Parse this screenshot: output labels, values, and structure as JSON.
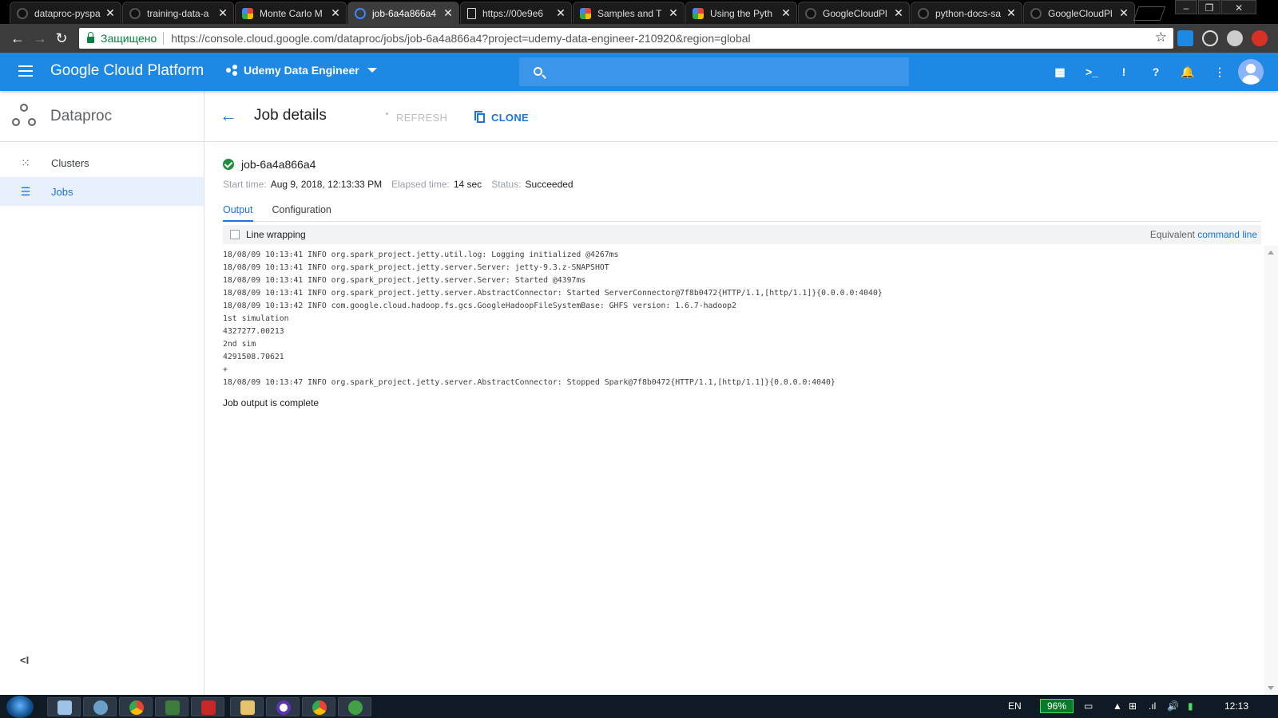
{
  "browser": {
    "tabs": [
      {
        "title": "dataproc-pyspa",
        "icon": "github-icon",
        "active": false
      },
      {
        "title": "training-data-a",
        "icon": "github-icon",
        "active": false
      },
      {
        "title": "Monte Carlo M",
        "icon": "google-cloud-icon",
        "active": false
      },
      {
        "title": "job-6a4a866a4",
        "icon": "dataproc-icon",
        "active": true
      },
      {
        "title": "https://00e9e6",
        "icon": "document-icon",
        "active": false
      },
      {
        "title": "Samples and T",
        "icon": "google-cloud-icon",
        "active": false
      },
      {
        "title": "Using the Pyth",
        "icon": "google-cloud-icon",
        "active": false
      },
      {
        "title": "GoogleCloudPl",
        "icon": "github-icon",
        "active": false
      },
      {
        "title": "python-docs-sa",
        "icon": "github-icon",
        "active": false
      },
      {
        "title": "GoogleCloudPl",
        "icon": "github-icon",
        "active": false
      }
    ],
    "secure_label": "Защищено",
    "url": "https://console.cloud.google.com/dataproc/jobs/job-6a4a866a4?project=udemy-data-engineer-210920&region=global"
  },
  "header": {
    "brand": "Google Cloud Platform",
    "project": "Udemy Data Engineer",
    "accent_color": "#1e88e5"
  },
  "sidebar": {
    "title": "Dataproc",
    "items": [
      {
        "label": "Clusters",
        "icon": "clusters-icon",
        "active": false
      },
      {
        "label": "Jobs",
        "icon": "list-icon",
        "active": true
      }
    ],
    "collapse_label": "<I"
  },
  "toolbar": {
    "title": "Job details",
    "refresh_label": "REFRESH",
    "clone_label": "CLONE"
  },
  "job": {
    "id": "job-6a4a866a4",
    "start_label": "Start time:",
    "start_time": "Aug 9, 2018, 12:13:33 PM",
    "elapsed_label": "Elapsed time:",
    "elapsed": "14 sec",
    "status_label": "Status:",
    "status": "Succeeded",
    "status_color": "#1e8e3e"
  },
  "tabs": {
    "output": "Output",
    "configuration": "Configuration"
  },
  "output": {
    "line_wrapping_label": "Line wrapping",
    "equivalent_prefix": "Equivalent",
    "command_line_link": "command line",
    "log_lines": [
      "18/08/09 10:13:41 INFO org.spark_project.jetty.util.log: Logging initialized @4267ms",
      "18/08/09 10:13:41 INFO org.spark_project.jetty.server.Server: jetty-9.3.z-SNAPSHOT",
      "18/08/09 10:13:41 INFO org.spark_project.jetty.server.Server: Started @4397ms",
      "18/08/09 10:13:41 INFO org.spark_project.jetty.server.AbstractConnector: Started ServerConnector@7f8b0472{HTTP/1.1,[http/1.1]}{0.0.0.0:4040}",
      "18/08/09 10:13:42 INFO com.google.cloud.hadoop.fs.gcs.GoogleHadoopFileSystemBase: GHFS version: 1.6.7-hadoop2",
      "1st simulation",
      "4327277.00213",
      "2nd sim",
      "4291508.70621",
      "+",
      "18/08/09 10:13:47 INFO org.spark_project.jetty.server.AbstractConnector: Stopped Spark@7f8b0472{HTTP/1.1,[http/1.1]}{0.0.0.0:4040}"
    ],
    "complete_message": "Job output is complete"
  },
  "taskbar": {
    "language": "EN",
    "battery": "96%",
    "clock": "12:13"
  }
}
